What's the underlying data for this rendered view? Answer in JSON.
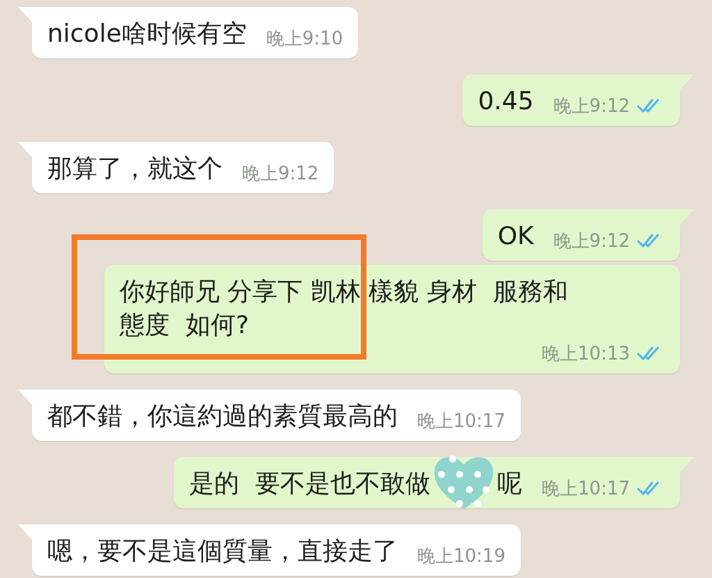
{
  "messages": [
    {
      "outgoing": false,
      "tail": true,
      "text": "nicole啥时候有空",
      "time": "晚上9:10"
    },
    {
      "outgoing": true,
      "tail": true,
      "text": "0.45",
      "time": "晚上9:12",
      "read": true
    },
    {
      "outgoing": false,
      "tail": true,
      "text": "那算了，就这个",
      "time": "晚上9:12"
    },
    {
      "outgoing": true,
      "tail": true,
      "text": "OK",
      "time": "晚上9:12",
      "read": true
    },
    {
      "outgoing": true,
      "tail": false,
      "text": "你好師兄 分享下 凯林 樣貌 身材  服務和態度  如何?",
      "time": "晚上10:13",
      "read": true,
      "highlighted": true
    },
    {
      "outgoing": false,
      "tail": true,
      "text": "都不錯，你這約過的素質最高的",
      "time": "晚上10:17"
    },
    {
      "outgoing": true,
      "tail": true,
      "kind": "redacted",
      "text": "是的  要不是也不敢做",
      "text_after": "呢",
      "time": "晚上10:17",
      "read": true
    },
    {
      "outgoing": false,
      "tail": true,
      "text": "嗯，要不是這個質量，直接走了",
      "time": "晚上10:19"
    }
  ]
}
